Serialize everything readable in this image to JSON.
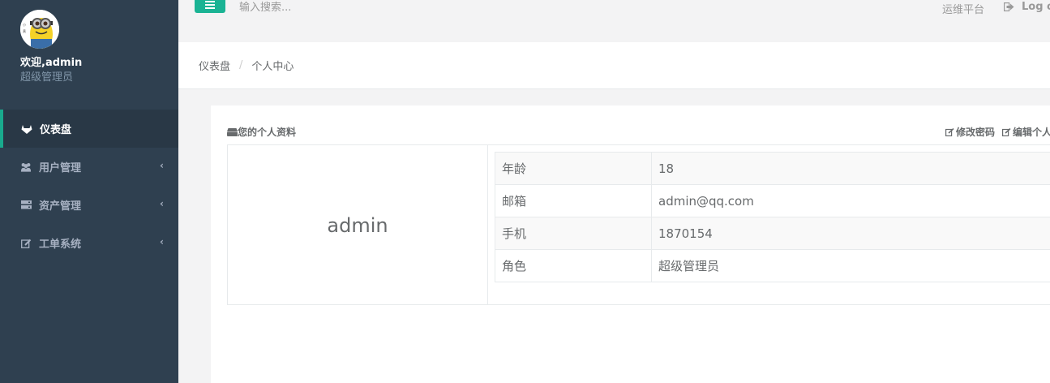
{
  "sidebar": {
    "welcome": "欢迎,admin",
    "role": "超级管理员",
    "items": [
      {
        "label": "仪表盘",
        "icon": "gitlab-icon",
        "active": true
      },
      {
        "label": "用户管理",
        "icon": "users-icon"
      },
      {
        "label": "资产管理",
        "icon": "server-icon"
      },
      {
        "label": "工单系统",
        "icon": "edit-icon"
      }
    ]
  },
  "header": {
    "search_placeholder": "输入搜索...",
    "platform_link": "运维平台",
    "logout": "Log out"
  },
  "breadcrumb": {
    "home": "仪表盘",
    "current": "个人中心"
  },
  "profile": {
    "title": "您的个人资料",
    "change_password": "修改密码",
    "edit_profile": "编辑个人",
    "username": "admin",
    "fields": [
      {
        "key": "年龄",
        "value": "18"
      },
      {
        "key": "邮箱",
        "value": "admin@qq.com"
      },
      {
        "key": "手机",
        "value": "1870154"
      },
      {
        "key": "角色",
        "value": "超级管理员"
      }
    ]
  },
  "colors": {
    "accent": "#1ab394",
    "sidebar": "#2f4050",
    "active_border": "#19aa8d"
  }
}
